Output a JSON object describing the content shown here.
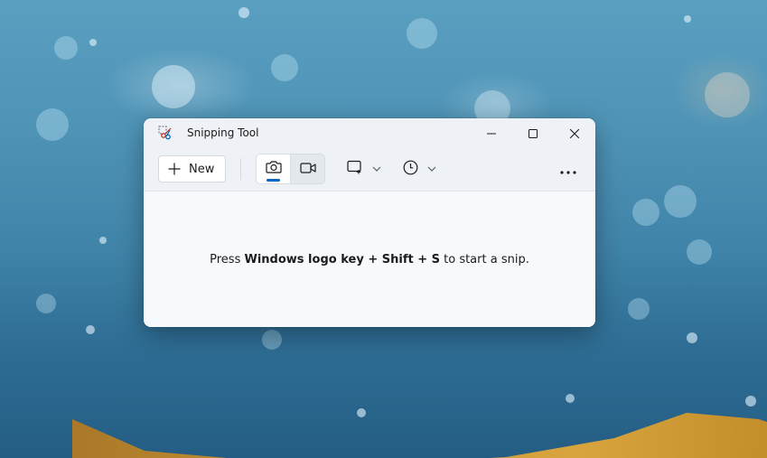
{
  "window": {
    "title": "Snipping Tool",
    "app_icon": "snipping-tool-icon",
    "caption": {
      "minimize_icon": "minimize-icon",
      "maximize_icon": "maximize-icon",
      "close_icon": "close-icon"
    }
  },
  "toolbar": {
    "new_label": "New",
    "new_icon": "plus-icon",
    "modes": [
      {
        "name": "snip",
        "icon": "camera-icon",
        "active": true
      },
      {
        "name": "record",
        "icon": "video-camera-icon",
        "active": false
      }
    ],
    "snip_shape_icon": "rectangle-snip-icon",
    "delay_icon": "clock-icon",
    "more_icon": "more-options-icon"
  },
  "content": {
    "prefix": "Press ",
    "shortcut": "Windows logo key + Shift + S",
    "suffix": " to start a snip."
  },
  "colors": {
    "accent": "#0067c0",
    "window_background": "#f3f6f8"
  }
}
